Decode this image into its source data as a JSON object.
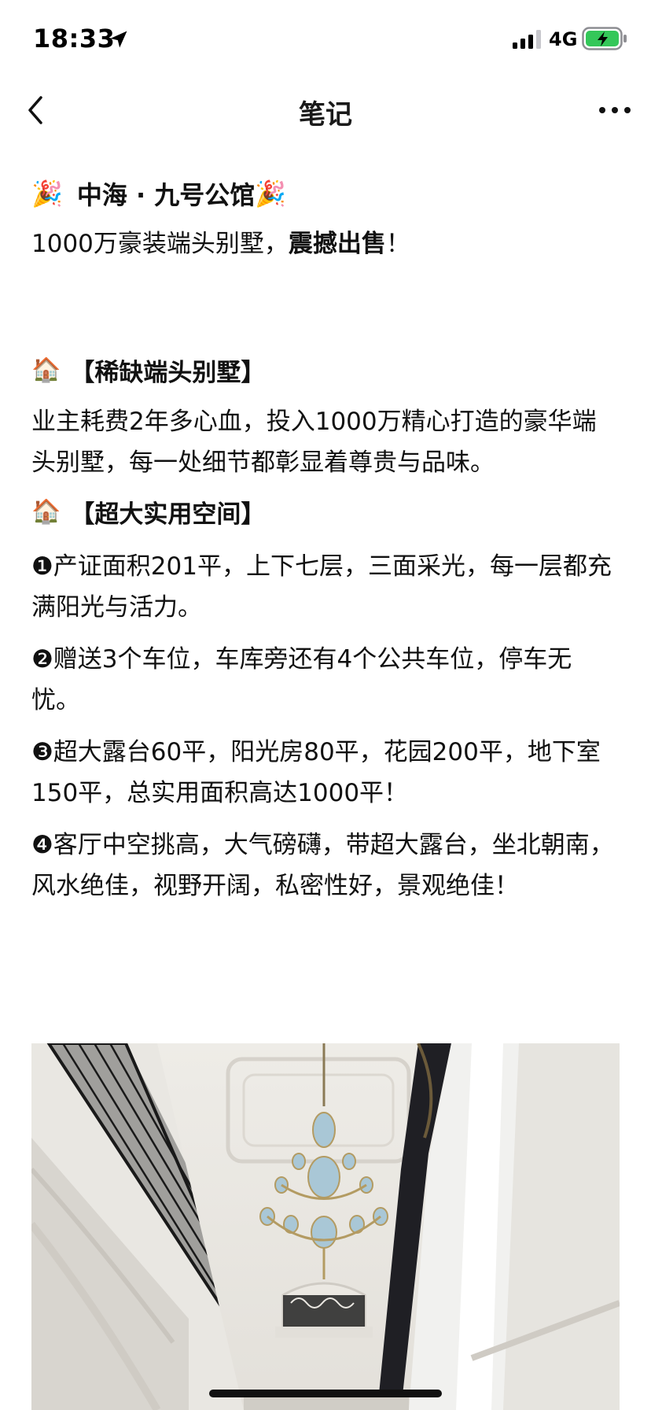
{
  "status_bar": {
    "time": "18:33",
    "network": "4G",
    "icons": [
      "location-arrow-icon",
      "signal-bars-icon",
      "battery-charging-icon"
    ],
    "battery_color": "#34c759"
  },
  "nav": {
    "title": "笔记",
    "back_icon": "chevron-left-icon",
    "more_icon": "more-dots-icon"
  },
  "article": {
    "headline": {
      "emoji_left": "🎉",
      "text": "中海 · 九号公馆",
      "emoji_right": "🎉"
    },
    "subline": {
      "text": "1000万豪装端头别墅，",
      "bold": "震撼出售",
      "suffix": "！"
    },
    "section_1": {
      "emoji": "🏠",
      "title": "【稀缺端头别墅】",
      "body": "业主耗费2年多心血，投入1000万精心打造的豪华端头别墅，每一处细节都彰显着尊贵与品味。"
    },
    "section_2": {
      "emoji": "🏠",
      "title": "【超大实用空间】",
      "items": [
        "❶产证面积201平，上下七层，三面采光，每一层都充满阳光与活力。",
        "❷赠送3个车位，车库旁还有4个公共车位，停车无忧。",
        "❸超大露台60平，阳光房80平，花园200平，地下室150平，总实用面积高达1000平！",
        "❹客厅中空挑高，大气磅礴，带超大露台，坐北朝南，风水绝佳，视野开阔，私密性好，景观绝佳！"
      ]
    }
  },
  "photo": {
    "subject": "villa-interior-chandelier-photo"
  }
}
